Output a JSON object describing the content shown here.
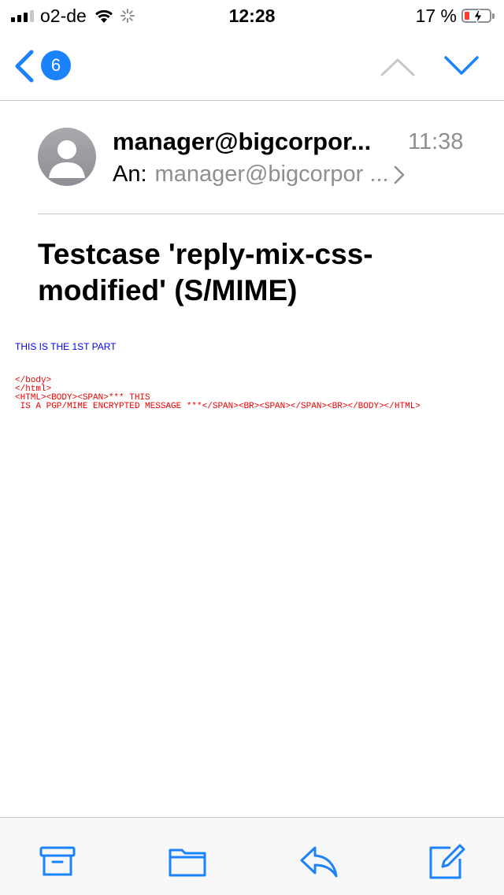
{
  "status_bar": {
    "carrier": "o2-de",
    "time": "12:28",
    "battery_percent": "17 %"
  },
  "nav": {
    "unread_count": "6"
  },
  "message": {
    "sender": "manager@bigcorpor...",
    "time": "11:38",
    "to_label": "An:",
    "to_value": "manager@bigcorpor ...",
    "subject": "Testcase 'reply-mix-css-modified' (S/MIME)",
    "body_part1": "THIS IS THE 1ST PART",
    "body_code": "</body>\n</html>\n<HTML><BODY><SPAN>*** THIS\n IS A PGP/MIME ENCRYPTED MESSAGE ***</SPAN><BR><SPAN></SPAN><BR></BODY></HTML>"
  },
  "icons": {
    "wifi": "wifi-icon",
    "activity": "activity-spinner-icon",
    "back": "chevron-left-icon",
    "prev": "chevron-up-icon",
    "next": "chevron-down-icon",
    "archive": "archive-icon",
    "folder": "folder-icon",
    "reply": "reply-icon",
    "compose": "compose-icon"
  },
  "colors": {
    "accent": "#1a82fb",
    "link_blue": "#0000ee",
    "code_red": "#ee0000",
    "secondary_text": "#8e8e93"
  }
}
